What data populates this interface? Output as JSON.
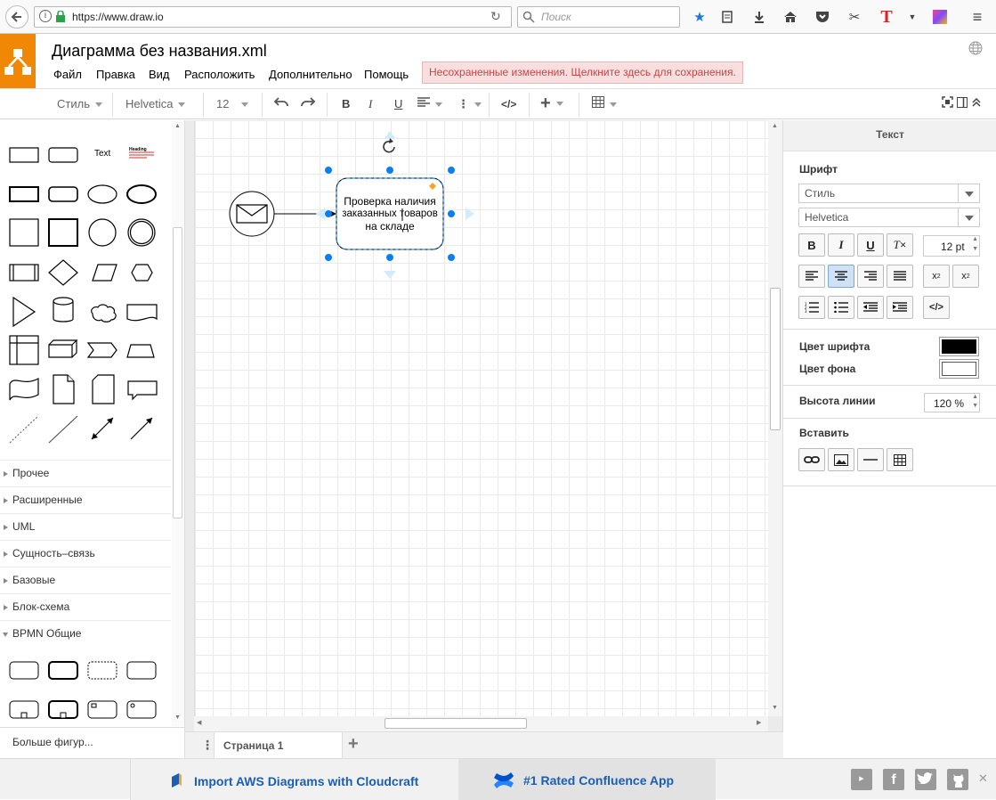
{
  "browser": {
    "url": "https://www.draw.io",
    "search_placeholder": "Поиск"
  },
  "app": {
    "title": "Диаграмма без названия.xml",
    "menu": [
      "Файл",
      "Правка",
      "Вид",
      "Расположить",
      "Дополнительно",
      "Помощь"
    ],
    "unsaved_notice": "Несохраненные изменения. Щелкните здесь для сохранения."
  },
  "toolbar": {
    "style_label": "Стиль",
    "font_label": "Helvetica",
    "size_label": "12"
  },
  "sidebar": {
    "text_shape_label": "Text",
    "heading_shape_label": "Heading",
    "sections": [
      "Прочее",
      "Расширенные",
      "UML",
      "Сущность–связь",
      "Базовые",
      "Блок-схема",
      "BPMN Общие"
    ],
    "more_shapes": "Больше фигур..."
  },
  "canvas": {
    "shape_text_line1": "Проверка наличия",
    "shape_text_line2": "заказанных товаров",
    "shape_text_line3": "на складе"
  },
  "format_panel": {
    "tab": "Текст",
    "font_section": "Шрифт",
    "style_select": "Стиль",
    "font_select": "Helvetica",
    "font_size": "12 pt",
    "font_color_label": "Цвет шрифта",
    "bg_color_label": "Цвет фона",
    "line_height_label": "Высота линии",
    "line_height_value": "120 %",
    "insert_label": "Вставить",
    "font_color": "#000000",
    "bg_color": "#ffffff"
  },
  "pages": {
    "current": "Страница 1"
  },
  "footer": {
    "ad1": "Import AWS Diagrams with Cloudcraft",
    "ad2": "#1 Rated Confluence App"
  },
  "colors": {
    "accent": "#f08705",
    "selection": "#0a7ff2",
    "unsaved_bg": "#f8dede",
    "unsaved_text": "#cc4444"
  }
}
